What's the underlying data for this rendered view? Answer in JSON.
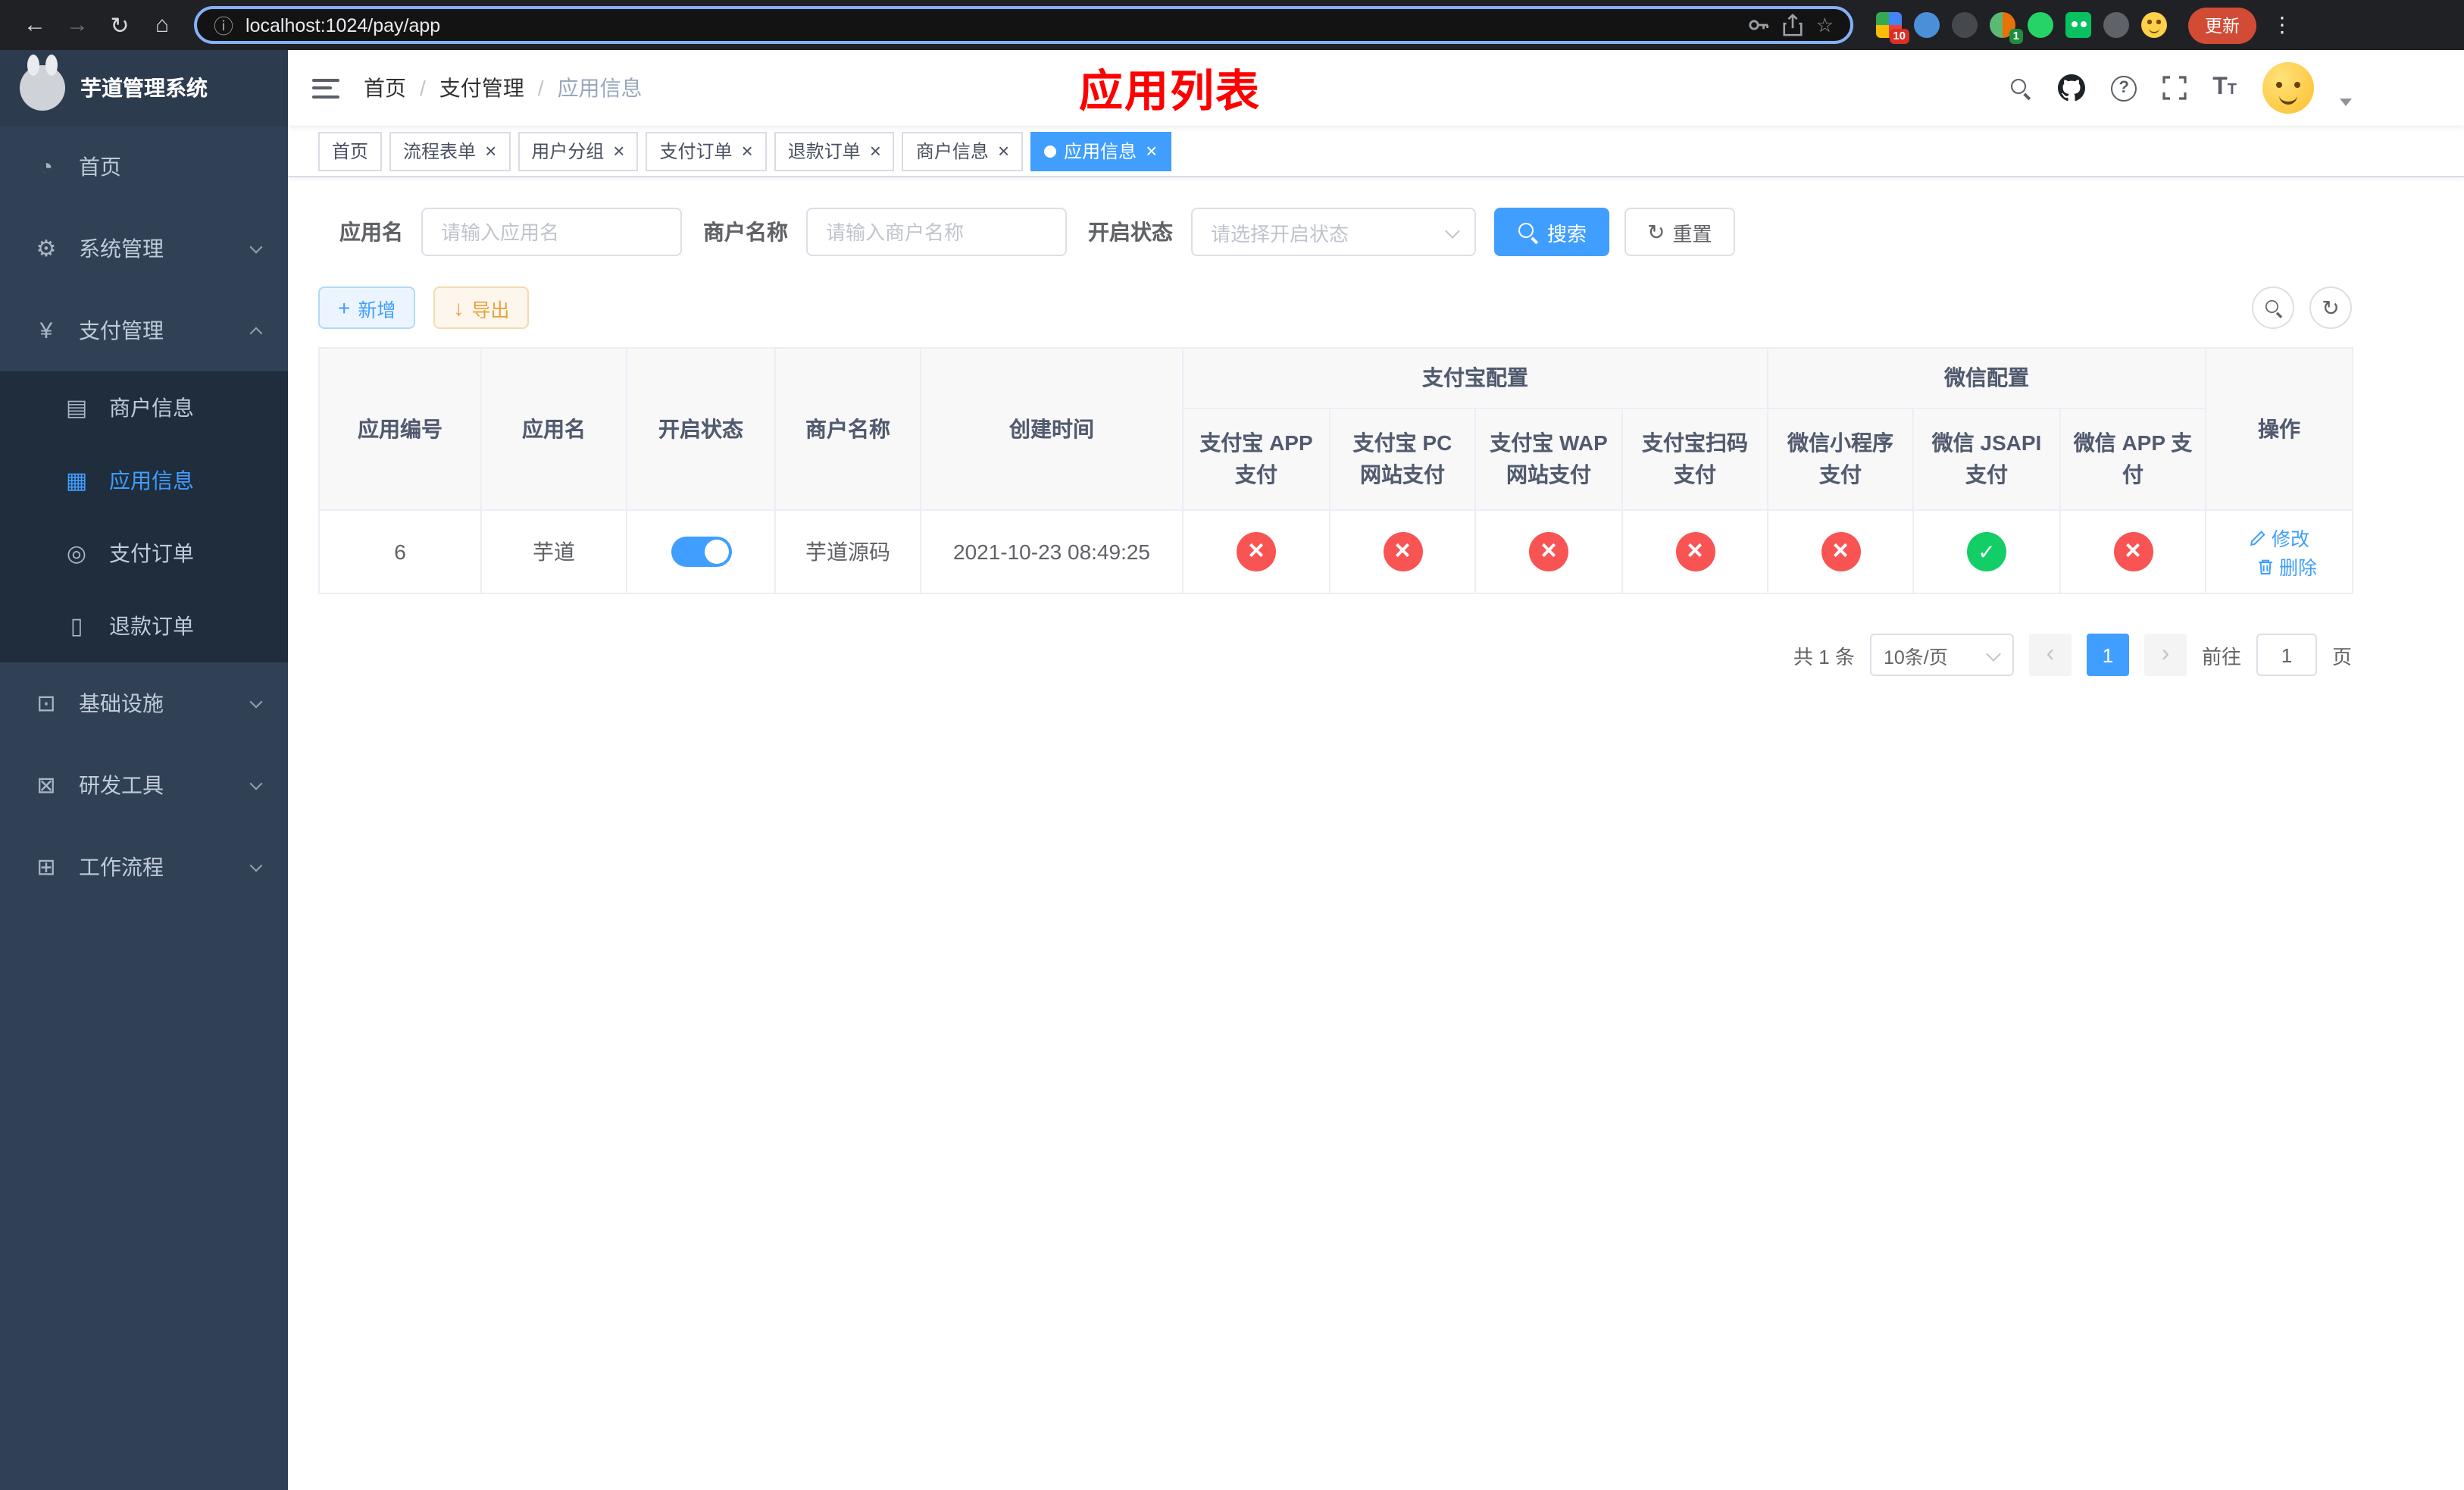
{
  "browser": {
    "url": "localhost:1024/pay/app",
    "update_button": "更新",
    "ext_badge_apps": "10",
    "ext_badge_translate": "1"
  },
  "app": {
    "title": "芋道管理系统"
  },
  "sidebar": {
    "items": [
      {
        "label": "首页"
      },
      {
        "label": "系统管理"
      },
      {
        "label": "支付管理"
      },
      {
        "label": "基础设施"
      },
      {
        "label": "研发工具"
      },
      {
        "label": "工作流程"
      }
    ],
    "pay_children": [
      {
        "label": "商户信息"
      },
      {
        "label": "应用信息"
      },
      {
        "label": "支付订单"
      },
      {
        "label": "退款订单"
      }
    ]
  },
  "breadcrumb": [
    "首页",
    "支付管理",
    "应用信息"
  ],
  "annotation": "应用列表",
  "tabs": [
    {
      "label": "首页"
    },
    {
      "label": "流程表单"
    },
    {
      "label": "用户分组"
    },
    {
      "label": "支付订单"
    },
    {
      "label": "退款订单"
    },
    {
      "label": "商户信息"
    },
    {
      "label": "应用信息"
    }
  ],
  "filters": {
    "name_label": "应用名",
    "name_placeholder": "请输入应用名",
    "merchant_label": "商户名称",
    "merchant_placeholder": "请输入商户名称",
    "status_label": "开启状态",
    "status_placeholder": "请选择开启状态",
    "search_button": "搜索",
    "reset_button": "重置"
  },
  "toolbar": {
    "add_button": "新增",
    "export_button": "导出"
  },
  "table": {
    "col_app_id": "应用编号",
    "col_app_name": "应用名",
    "col_status": "开启状态",
    "col_merchant": "商户名称",
    "col_created": "创建时间",
    "group_alipay": "支付宝配置",
    "group_wechat": "微信配置",
    "col_alipay_app": "支付宝 APP 支付",
    "col_alipay_pc": "支付宝 PC 网站支付",
    "col_alipay_wap": "支付宝 WAP 网站支付",
    "col_alipay_qr": "支付宝扫码支付",
    "col_wx_lite": "微信小程序支付",
    "col_wx_jsapi": "微信 JSAPI 支付",
    "col_wx_app": "微信 APP 支付",
    "col_ops": "操作",
    "rows": [
      {
        "id": "6",
        "name": "芋道",
        "enabled": "on",
        "merchant": "芋道源码",
        "created": "2021-10-23 08:49:25",
        "alipay_app": "off",
        "alipay_pc": "off",
        "alipay_wap": "off",
        "alipay_qr": "off",
        "wx_lite": "off",
        "wx_jsapi": "on",
        "wx_app": "off",
        "op_edit": "修改",
        "op_delete": "删除"
      }
    ]
  },
  "pagination": {
    "total": "共 1 条",
    "page_size": "10条/页",
    "current_page": "1",
    "goto_label": "前往",
    "goto_value": "1",
    "goto_suffix": "页"
  },
  "icons": {
    "back": "←",
    "forward": "→",
    "reload": "↻",
    "home": "⌂",
    "info": "ⓘ",
    "star": "☆",
    "more": "⋮",
    "question": "?",
    "fontsize": "T",
    "plus": "+",
    "download": "↓",
    "refresh": "↻",
    "close": "×",
    "prev": "‹",
    "next": "›",
    "menu_home": "◔",
    "menu_system": "⚙",
    "menu_pay": "¥",
    "menu_merchant": "▤",
    "menu_app": "▦",
    "menu_order": "◎",
    "menu_refund": "▯",
    "menu_infra": "⊡",
    "menu_dev": "⊠",
    "menu_flow": "⊞"
  }
}
